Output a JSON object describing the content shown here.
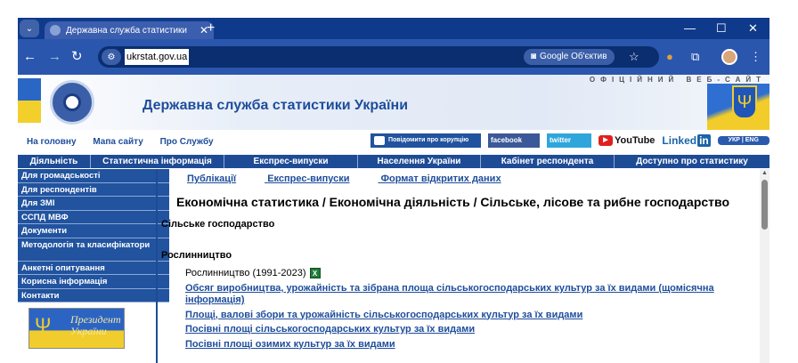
{
  "browser": {
    "tab_title": "Державна служба статистики",
    "url": "ukrstat.gov.ua",
    "lens_label": "Google Об'єктив",
    "icons": [
      "tab-search-icon",
      "close-tab-icon",
      "new-tab-icon",
      "minimize-icon",
      "maximize-icon",
      "close-window-icon",
      "back-icon",
      "forward-icon",
      "reload-icon",
      "site-info-icon",
      "lens-icon",
      "bookmark-star-icon",
      "extension-icon",
      "puzzle-icon",
      "profile-avatar",
      "menu-icon"
    ]
  },
  "header": {
    "official": "ОФІЦІЙНИЙ ВЕБ-САЙТ",
    "site_title": "Державна служба статистики України",
    "toplinks": [
      "На головну",
      "Мапа сайту",
      "Про Службу"
    ],
    "partners": {
      "corruption": "Повідомити про корупцію",
      "facebook": "facebook",
      "twitter": "twitter",
      "youtube": "YouTube",
      "linkedin": "Linked",
      "linkedin_in": "in",
      "lang": "УКР | ENG"
    }
  },
  "topnav": [
    "Діяльність",
    "Статистична інформація",
    "Експрес-випуски",
    "Населення України",
    "Кабінет респондента",
    "Доступно про статистику"
  ],
  "leftnav": [
    "Для громадськості",
    "Для респондентів",
    "Для ЗМІ",
    "ССПД МВФ",
    "Документи",
    "Методологія та класифікатори",
    "Анкетні опитування",
    "Корисна інформація",
    "Контакти"
  ],
  "president_banner": "Президент України",
  "content": {
    "subtabs": [
      "Публікації",
      "Експрес-випуски",
      "Формат відкритих даних"
    ],
    "path_title": "Економічна статистика / Економічна діяльність / Сільське, лісове та рибне господарство",
    "section": "Сільське господарство",
    "subsection": "Рослинництво",
    "plain_item": "Рослинництво (1991-2023)",
    "links": [
      "Обсяг виробництва, урожайність та зібрана площа сільськогосподарських культур за їх видами (щомісячна інформація)",
      "Площі, валові збори та урожайність сільськогосподарських культур за їх видами",
      "Посівні площі сільськогосподарських культур за їх видами",
      "Посівні площі озимих культур за їх видами"
    ]
  }
}
